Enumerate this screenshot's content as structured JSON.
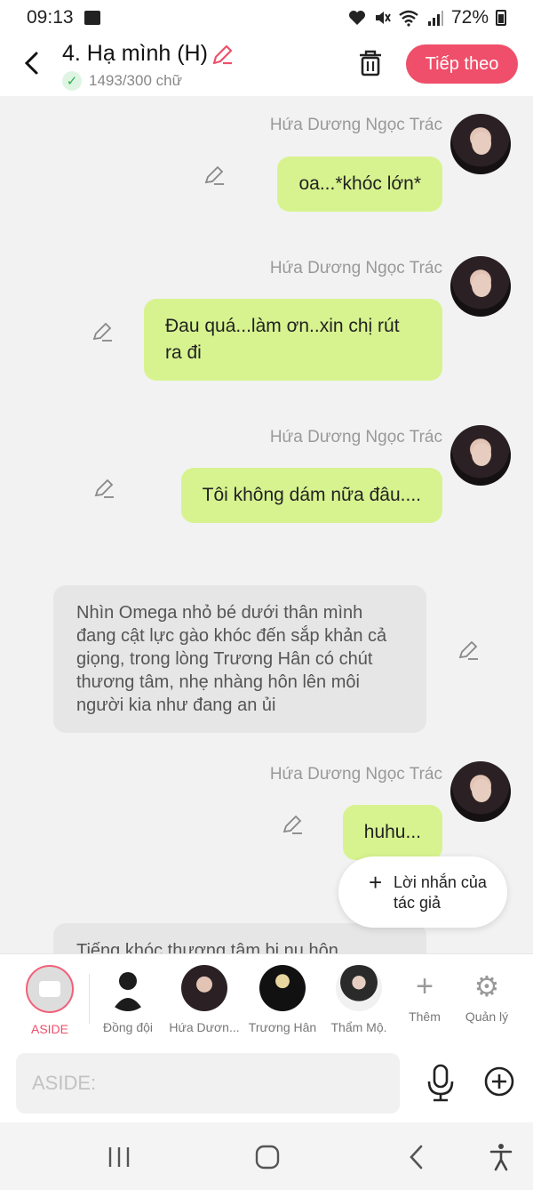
{
  "status": {
    "time": "09:13",
    "battery": "72%",
    "icons": [
      "image-icon",
      "heart-icon",
      "mute-icon",
      "wifi-icon",
      "signal-icon",
      "battery-icon"
    ]
  },
  "header": {
    "title": "4. Hạ mình (H)",
    "word_count": "1493/300 chữ",
    "next_label": "Tiếp theo"
  },
  "colors": {
    "accent": "#ef4f6a",
    "bubble_out": "#d7f38f",
    "bubble_in": "#e6e6e6",
    "check": "#27b24a"
  },
  "messages": [
    {
      "sender": "Hứa Dương Ngọc Trác",
      "text": "oa...*khóc lớn*"
    },
    {
      "sender": "Hứa Dương Ngọc Trác",
      "text": "Đau quá...làm ơn..xin chị rút ra đi"
    },
    {
      "sender": "Hứa Dương Ngọc Trác",
      "text": "Tôi không dám nữa đâu...."
    },
    {
      "narration": "Nhìn Omega nhỏ bé dưới thân mình đang cật lực gào khóc đến sắp khản cả giọng, trong lòng Trương Hân có chút thương tâm, nhẹ nhàng hôn lên môi người kia như đang an ủi"
    },
    {
      "sender": "Hứa Dương Ngọc Trác",
      "text": "huhu..."
    },
    {
      "narration": "Tiếng khóc thương tâm bị nụ hôn"
    }
  ],
  "author_note": "Lời nhắn của tác giả",
  "characters": [
    {
      "label": "ASIDE"
    },
    {
      "label": "Đồng đội"
    },
    {
      "label": "Hứa Dươn..."
    },
    {
      "label": "Trương Hân"
    },
    {
      "label": "Thẩm Mộ."
    },
    {
      "label": "Thêm"
    },
    {
      "label": "Quản lý"
    }
  ],
  "input": {
    "placeholder": "ASIDE:"
  }
}
